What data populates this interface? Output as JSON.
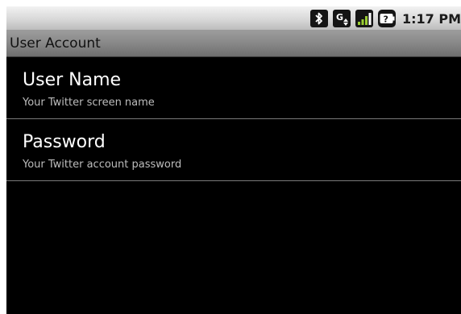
{
  "status_bar": {
    "time": "1:17 PM",
    "icons": [
      "bluetooth-icon",
      "data-network-icon",
      "signal-strength-icon",
      "battery-unknown-icon"
    ]
  },
  "title_bar": {
    "title": "User Account"
  },
  "preferences": [
    {
      "title": "User Name",
      "summary": "Your Twitter screen name"
    },
    {
      "title": "Password",
      "summary": "Your Twitter account password"
    }
  ]
}
